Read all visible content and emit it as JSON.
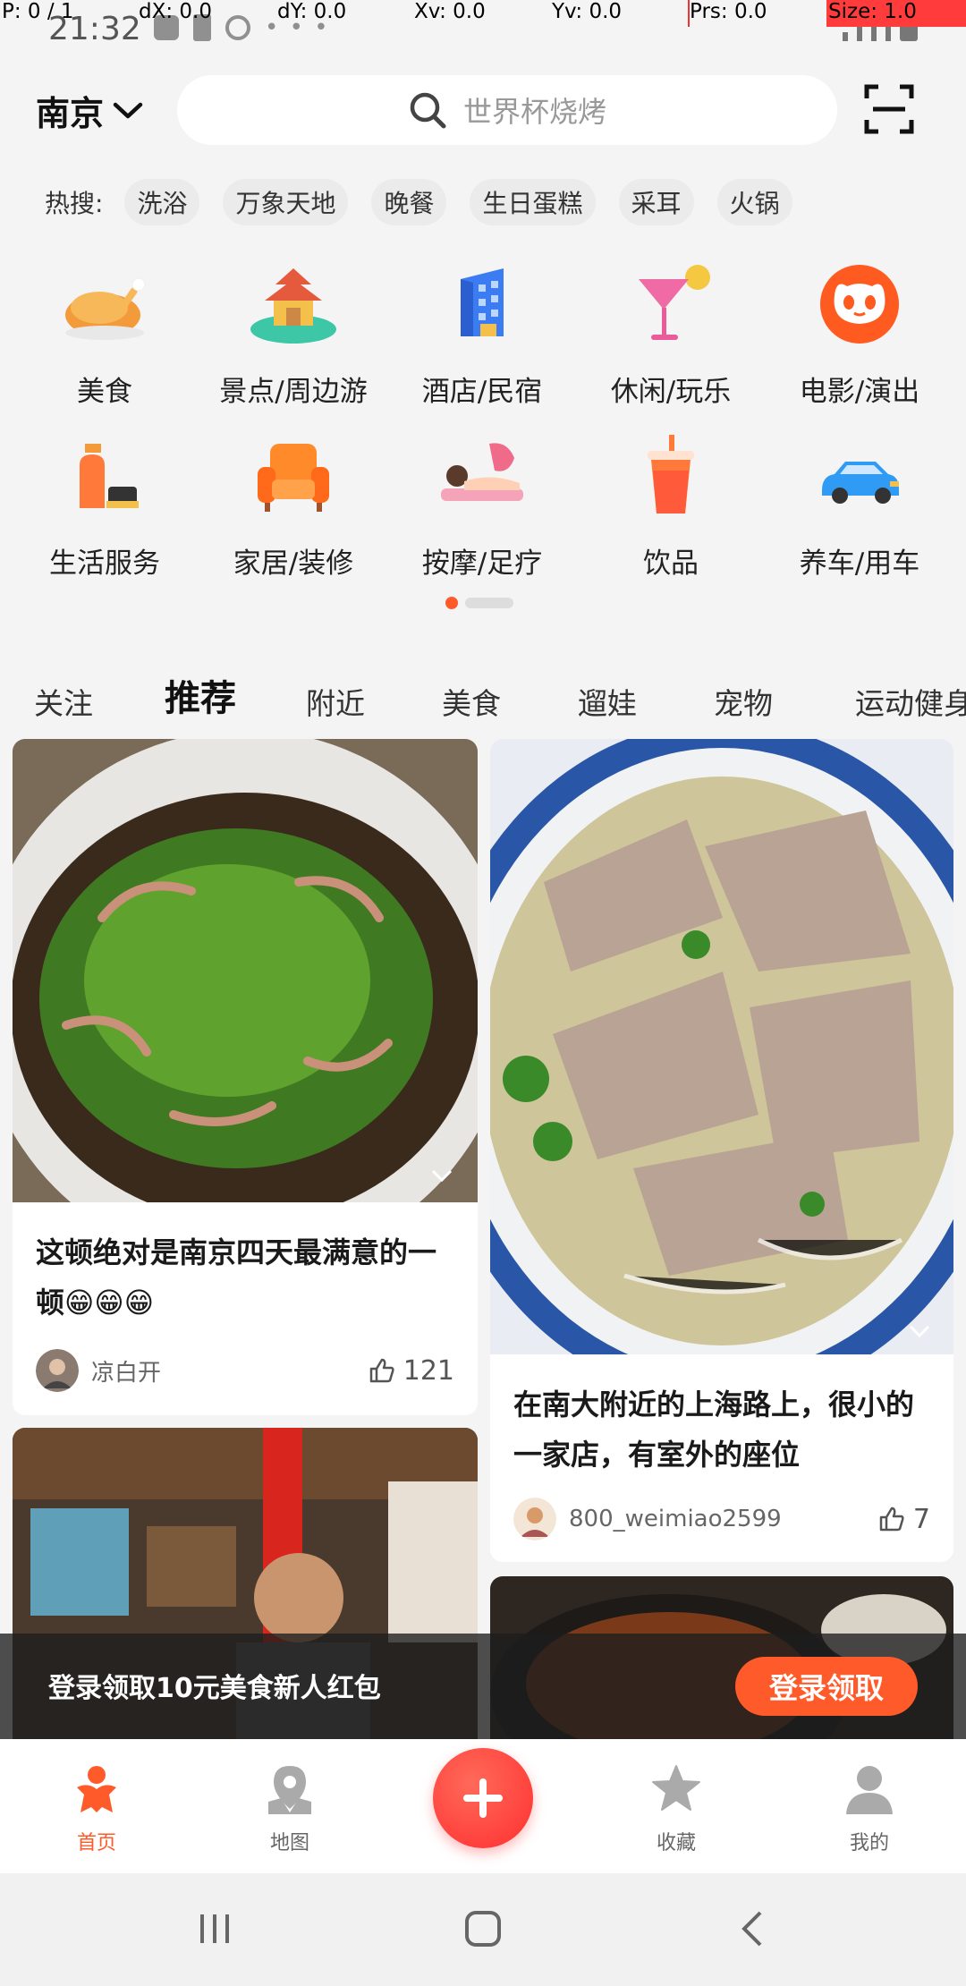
{
  "debug": {
    "p": "P: 0 / 1",
    "dx": "dX: 0.0",
    "dy": "dY: 0.0",
    "xv": "Xv: 0.0",
    "yv": "Yv: 0.0",
    "prs": "Prs: 0.0",
    "size": "Size: 1.0"
  },
  "status": {
    "time": "21:32",
    "dots": "• • •"
  },
  "header": {
    "city": "南京",
    "search_placeholder": "世界杯烧烤"
  },
  "hot": {
    "label": "热搜:",
    "items": [
      "洗浴",
      "万象天地",
      "晚餐",
      "生日蛋糕",
      "采耳",
      "火锅"
    ]
  },
  "categories": [
    {
      "label": "美食",
      "icon": "roast-chicken-icon"
    },
    {
      "label": "景点/周边游",
      "icon": "pavilion-icon"
    },
    {
      "label": "酒店/民宿",
      "icon": "hotel-building-icon"
    },
    {
      "label": "休闲/玩乐",
      "icon": "cocktail-icon"
    },
    {
      "label": "电影/演出",
      "icon": "cat-face-icon"
    },
    {
      "label": "生活服务",
      "icon": "cleaning-spray-icon"
    },
    {
      "label": "家居/装修",
      "icon": "armchair-icon"
    },
    {
      "label": "按摩/足疗",
      "icon": "massage-icon"
    },
    {
      "label": "饮品",
      "icon": "drink-cup-icon"
    },
    {
      "label": "养车/用车",
      "icon": "car-icon"
    }
  ],
  "tabs": [
    "关注",
    "推荐",
    "附近",
    "美食",
    "遛娃",
    "宠物",
    "运动健身"
  ],
  "active_tab": "推荐",
  "cards": [
    {
      "title": "这顿绝对是南京四天最满意的一顿😁😁😁",
      "user": "凉白开",
      "likes": "121",
      "image": "noodle-soup-with-scallions"
    },
    {
      "title": "在南大附近的上海路上，很小的一家店，有室外的座位",
      "user": "800_weimiao2599",
      "likes": "7",
      "image": "beef-noodle-soup"
    },
    {
      "image": "restaurant-interior-with-diner"
    },
    {
      "image": "braised-dish-in-pot"
    }
  ],
  "banner": {
    "text": "登录领取10元美食新人红包",
    "button": "登录领取"
  },
  "nav": {
    "home": "首页",
    "map": "地图",
    "fav": "收藏",
    "me": "我的"
  },
  "colors": {
    "accent": "#ff5a2a",
    "fab": "#ff3a3a"
  }
}
